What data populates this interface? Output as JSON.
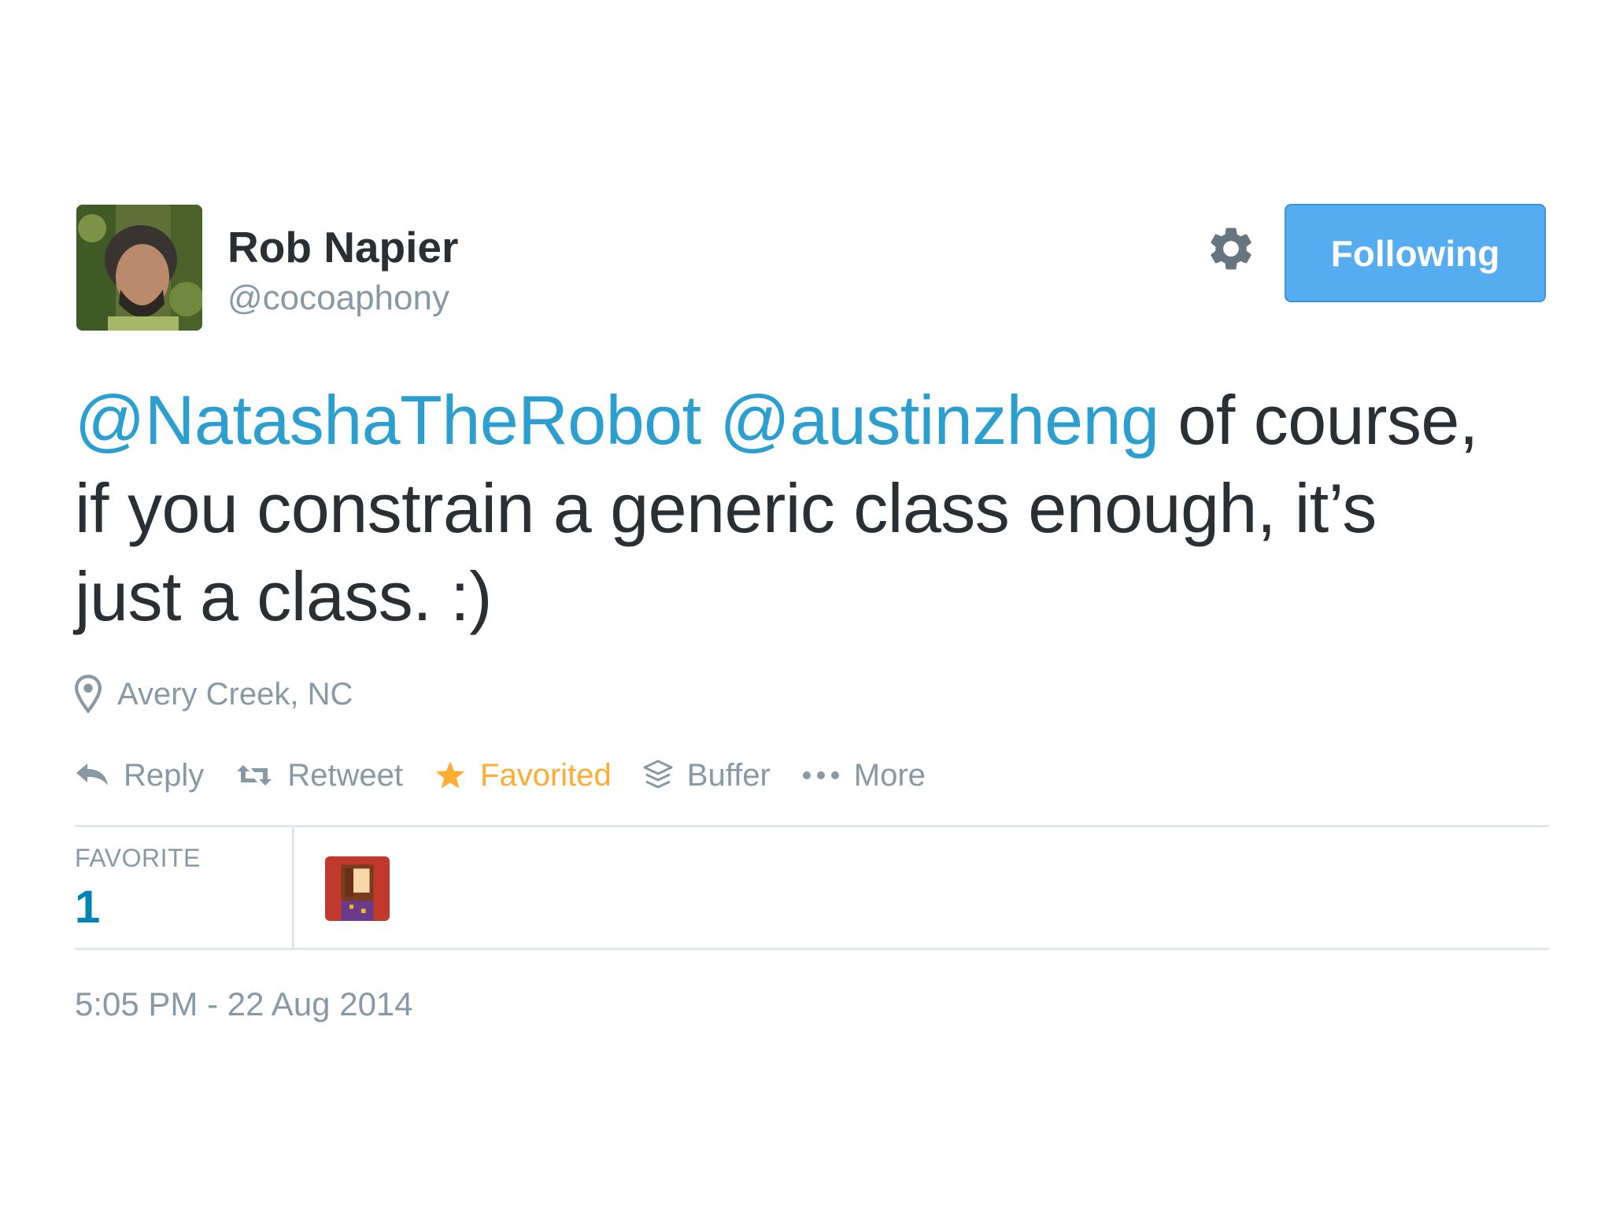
{
  "author": {
    "display_name": "Rob Napier",
    "handle": "@cocoaphony",
    "avatar_icon": "profile-photo"
  },
  "header": {
    "gear_icon": "gear-icon",
    "follow_button_label": "Following"
  },
  "tweet": {
    "mention_1": "@NatashaTheRobot",
    "mention_2": "@austinzheng",
    "text_line_1_rest": "of course,",
    "text_line_2": "if you constrain a generic class enough, it’s",
    "text_line_3": "just a class. :)"
  },
  "location": {
    "icon": "map-pin-icon",
    "text": "Avery Creek, NC"
  },
  "actions": {
    "reply": "Reply",
    "retweet": "Retweet",
    "favorited": "Favorited",
    "buffer": "Buffer",
    "more": "More"
  },
  "stats": {
    "favorite_label": "FAVORITE",
    "favorite_count": "1"
  },
  "timestamp": "5:05 PM - 22 Aug 2014",
  "colors": {
    "accent_blue": "#55acee",
    "mention_blue": "#2b9fd0",
    "favorite_orange": "#ffac33",
    "muted_gray": "#8899a6",
    "text_dark": "#292f33"
  }
}
